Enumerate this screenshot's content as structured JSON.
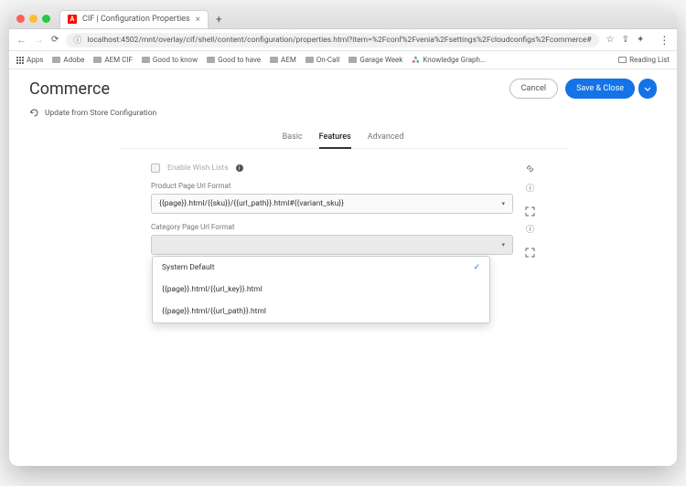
{
  "browser": {
    "tab_title": "CIF | Configuration Properties",
    "url": "localhost:4502/mnt/overlay/cif/shell/content/configuration/properties.html?item=%2Fconf%2Fvenia%2Fsettings%2Fcloudconfigs%2Fcommerce#",
    "bookmarks": {
      "apps": "Apps",
      "items": [
        "Adobe",
        "AEM CIF",
        "Good to know",
        "Good to have",
        "AEM",
        "On-Call",
        "Garage Week"
      ],
      "knowledge": "Knowledge Graph…",
      "reading_list": "Reading List"
    }
  },
  "page": {
    "title": "Commerce",
    "cancel": "Cancel",
    "save": "Save & Close",
    "update_action": "Update from Store Configuration"
  },
  "tabs": {
    "basic": "Basic",
    "features": "Features",
    "advanced": "Advanced"
  },
  "form": {
    "wishlist_label": "Enable Wish Lists",
    "product_label": "Product Page Url Format",
    "product_value": "{{page}}.html/{{sku}}/{{url_path}}.html#{{variant_sku}}",
    "category_label": "Category Page Url Format",
    "category_value": "",
    "dropdown": {
      "opt0": "System Default",
      "opt1": "{{page}}.html/{{url_key}}.html",
      "opt2": "{{page}}.html/{{url_path}}.html"
    }
  }
}
